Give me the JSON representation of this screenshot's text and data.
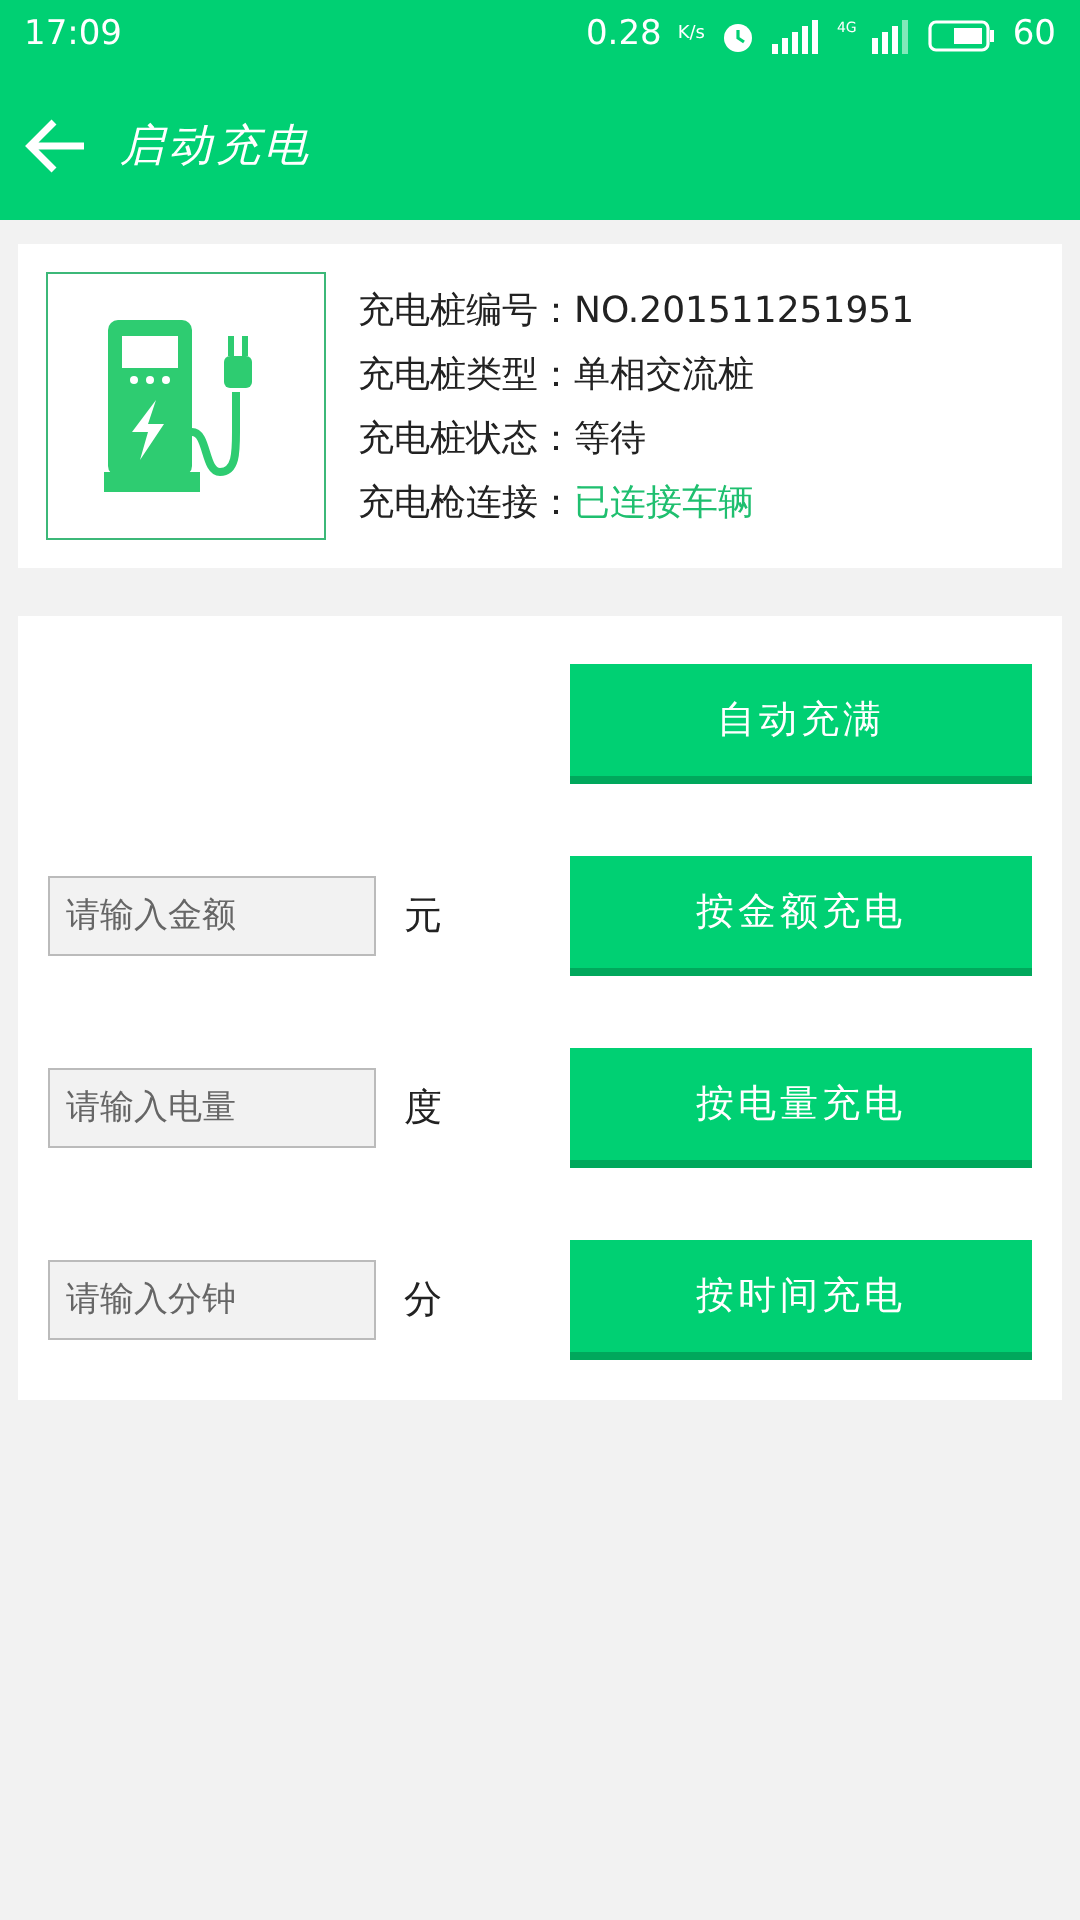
{
  "status_bar": {
    "time": "17:09",
    "speed": "0.28",
    "speed_unit": "K/s",
    "network": "4G",
    "battery": "60"
  },
  "header": {
    "title": "启动充电"
  },
  "station": {
    "rows": [
      {
        "label": "充电桩编号：",
        "value": "NO.201511251951",
        "color": "#222222"
      },
      {
        "label": "充电桩类型：",
        "value": "单相交流桩",
        "color": "#222222"
      },
      {
        "label": "充电桩状态：",
        "value": "等待",
        "color": "#222222"
      },
      {
        "label": "充电枪连接：",
        "value": "已连接车辆",
        "color": "#1fbf6f"
      }
    ]
  },
  "actions": [
    {
      "kind": "button",
      "button": "自动充满"
    },
    {
      "kind": "input",
      "placeholder": "请输入金额",
      "unit": "元",
      "button": "按金额充电"
    },
    {
      "kind": "input",
      "placeholder": "请输入电量",
      "unit": "度",
      "button": "按电量充电"
    },
    {
      "kind": "input",
      "placeholder": "请输入分钟",
      "unit": "分",
      "button": "按时间充电"
    }
  ]
}
